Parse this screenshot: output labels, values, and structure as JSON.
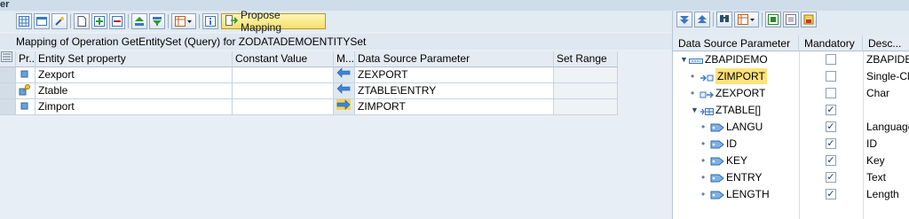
{
  "window": {
    "title_fragment": "er"
  },
  "toolbar": {
    "propose_label": "Propose Mapping",
    "icons": [
      "grid-icon",
      "table-view-icon",
      "wizard-icon",
      "new-document-icon",
      "insert-row-icon",
      "delete-row-icon",
      "sort-ascending-icon",
      "filter-icon",
      "layout-icon",
      "info-icon",
      "propose-mapping-icon"
    ]
  },
  "caption": "Mapping of Operation GetEntitySet (Query) for ZODATADEMOENTITYSet",
  "mapping_table": {
    "headers": [
      "Pr...",
      "Entity Set property",
      "Constant Value",
      "M...",
      "Data Source Parameter",
      "Set Range"
    ],
    "rows": [
      {
        "property": "Zexport",
        "constant": "",
        "direction": "import",
        "source": "ZEXPORT",
        "range": "",
        "key": false
      },
      {
        "property": "Ztable",
        "constant": "",
        "direction": "import",
        "source": "ZTABLE\\ENTRY",
        "range": "",
        "key": true
      },
      {
        "property": "Zimport",
        "constant": "",
        "direction": "export",
        "source": "ZIMPORT",
        "range": "",
        "key": false
      }
    ]
  },
  "right_panel": {
    "toolbar_icons": [
      "expand-icon",
      "collapse-icon",
      "find-icon",
      "layout-icon",
      "details-icon",
      "settings-icon",
      "export-icon"
    ],
    "headers": [
      "Data Source Parameter",
      "Mandatory",
      "Desc..."
    ],
    "rows": [
      {
        "name": "ZBAPIDEMO",
        "indent": 0,
        "node": "expanded",
        "icon": "structure-icon",
        "mandatory": false,
        "desc": "ZBAPIDE",
        "highlight": false
      },
      {
        "name": "ZIMPORT",
        "indent": 1,
        "node": "leaf",
        "icon": "import-param-icon",
        "mandatory": false,
        "desc": "Single-Cl",
        "highlight": true
      },
      {
        "name": "ZEXPORT",
        "indent": 1,
        "node": "leaf",
        "icon": "export-param-icon",
        "mandatory": false,
        "desc": "Char",
        "highlight": false
      },
      {
        "name": "ZTABLE[]",
        "indent": 1,
        "node": "expanded",
        "icon": "table-param-icon",
        "mandatory": true,
        "desc": "",
        "highlight": false
      },
      {
        "name": "LANGU",
        "indent": 2,
        "node": "leaf",
        "icon": "field-icon",
        "mandatory": true,
        "desc": "Language",
        "highlight": false
      },
      {
        "name": "ID",
        "indent": 2,
        "node": "leaf",
        "icon": "field-icon",
        "mandatory": true,
        "desc": "ID",
        "highlight": false
      },
      {
        "name": "KEY",
        "indent": 2,
        "node": "leaf",
        "icon": "field-icon",
        "mandatory": true,
        "desc": "Key",
        "highlight": false
      },
      {
        "name": "ENTRY",
        "indent": 2,
        "node": "leaf",
        "icon": "field-icon",
        "mandatory": true,
        "desc": "Text",
        "highlight": false
      },
      {
        "name": "LENGTH",
        "indent": 2,
        "node": "leaf",
        "icon": "field-icon",
        "mandatory": true,
        "desc": "Length",
        "highlight": false
      }
    ]
  },
  "colors": {
    "accent": "#3a78c0",
    "arrow_import": "#3a86d6",
    "arrow_export_bg": "#f3d35a",
    "highlight": "#ffe27a"
  }
}
